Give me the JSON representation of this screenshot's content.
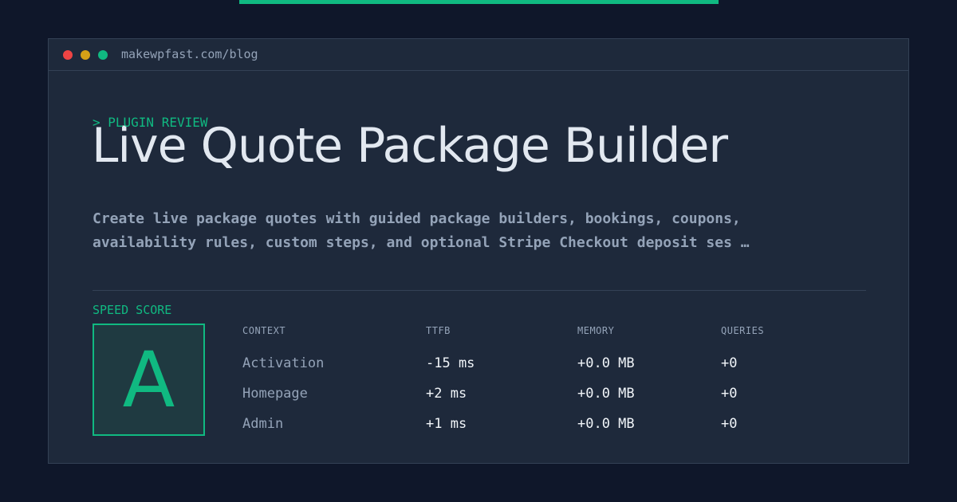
{
  "window": {
    "url": "makewpfast.com/blog",
    "dots": [
      "#ef4444",
      "#d4a017",
      "#10b981"
    ]
  },
  "article": {
    "kicker": "> PLUGIN REVIEW",
    "title": "Live Quote Package Builder",
    "description_lines": [
      "Create live package quotes with guided package builders, bookings, coupons,",
      "availability rules, custom steps, and optional Stripe Checkout deposit ses …"
    ]
  },
  "score": {
    "label": "SPEED SCORE",
    "grade": "A"
  },
  "metrics": {
    "headers": [
      "CONTEXT",
      "TTFB",
      "MEMORY",
      "QUERIES"
    ],
    "rows": [
      [
        "Activation",
        "-15 ms",
        "+0.0 MB",
        "+0"
      ],
      [
        "Homepage",
        "+2 ms",
        "+0.0 MB",
        "+0"
      ],
      [
        "Admin",
        "+1 ms",
        "+0.0 MB",
        "+0"
      ]
    ]
  },
  "colors": {
    "accent": "#10b981",
    "background": "#0f172a",
    "panel": "#1e293b"
  }
}
